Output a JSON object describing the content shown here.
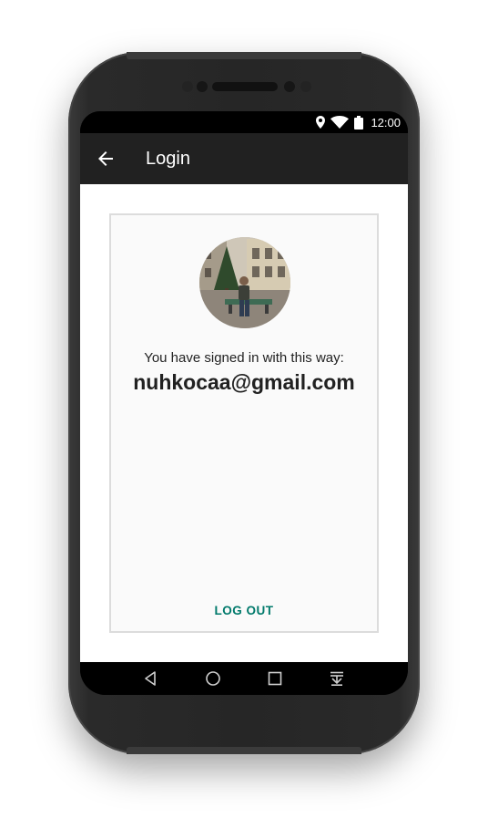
{
  "status_bar": {
    "time": "12:00",
    "icons": [
      "location-icon",
      "wifi-icon",
      "battery-icon"
    ]
  },
  "app_bar": {
    "title": "Login",
    "back_icon": "arrow-left-icon"
  },
  "profile": {
    "avatar_description": "circular profile photo",
    "signed_in_label": "You have signed in with this way:",
    "email": "nuhkocaa@gmail.com"
  },
  "actions": {
    "logout_label": "LOG OUT"
  },
  "nav_bar": {
    "icons": [
      "back-triangle-icon",
      "home-circle-icon",
      "recents-square-icon",
      "notification-pull-icon"
    ]
  },
  "colors": {
    "app_bar": "#212121",
    "accent": "#00796b",
    "card_bg": "#fafafa",
    "card_border": "#dcdcdc"
  }
}
